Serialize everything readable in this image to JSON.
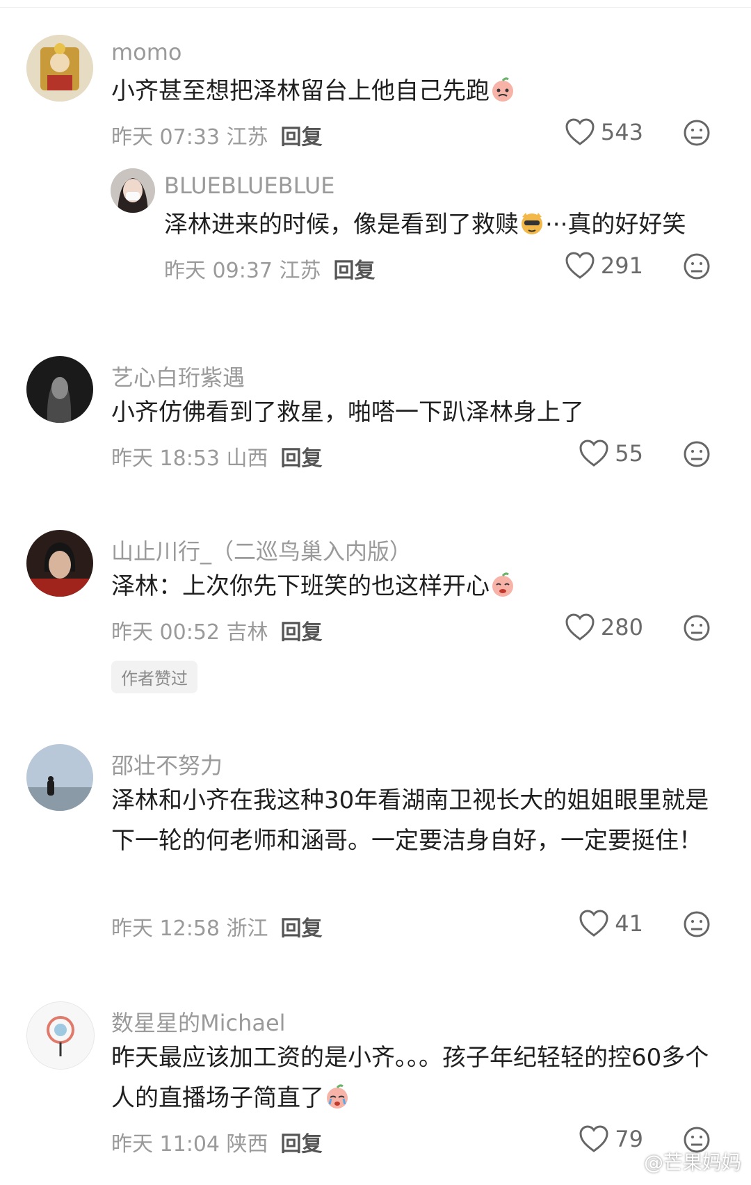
{
  "comments": [
    {
      "username": "momo",
      "text": "小齐甚至想把泽林留台上他自己先跑",
      "emoji": "peach-crying-emoji",
      "meta": "昨天 07:33 江苏",
      "reply_label": "回复",
      "likes": "543",
      "reply": {
        "username": "BLUEBLUEBLUE",
        "text_before": "泽林进来的时候，像是看到了救赎",
        "emoji": "cool-dog-emoji",
        "text_after": "···真的好好笑",
        "meta": "昨天 09:37 江苏",
        "reply_label": "回复",
        "likes": "291"
      }
    },
    {
      "username": "艺心白珩紫遇",
      "text": "小齐仿佛看到了救星，啪嗒一下趴泽林身上了",
      "meta": "昨天 18:53 山西",
      "reply_label": "回复",
      "likes": "55"
    },
    {
      "username": "山止川行_（二巡鸟巢入内版）",
      "text": "泽林：上次你先下班笑的也这样开心",
      "emoji": "peach-laughing-emoji",
      "meta": "昨天 00:52 吉林",
      "reply_label": "回复",
      "likes": "280",
      "badge": "作者赞过"
    },
    {
      "username": "邵壮不努力",
      "text": "泽林和小齐在我这种30年看湖南卫视长大的姐姐眼里就是下一轮的何老师和涵哥。一定要洁身自好，一定要挺住！",
      "meta": "昨天 12:58 浙江",
      "reply_label": "回复",
      "likes": "41"
    },
    {
      "username": "数星星的Michael",
      "text": "昨天最应该加工资的是小齐。。。孩子年纪轻轻的控60多个人的直播场子简直了",
      "emoji": "peach-crying-emoji",
      "meta": "昨天 11:04 陕西",
      "reply_label": "回复",
      "likes": "79"
    }
  ],
  "watermark": "@芒果妈妈",
  "colors": {
    "username": "#9a9a9a",
    "text": "#1f1f1f",
    "meta": "#9a9a9a",
    "badge_bg": "#f2f2f2"
  }
}
